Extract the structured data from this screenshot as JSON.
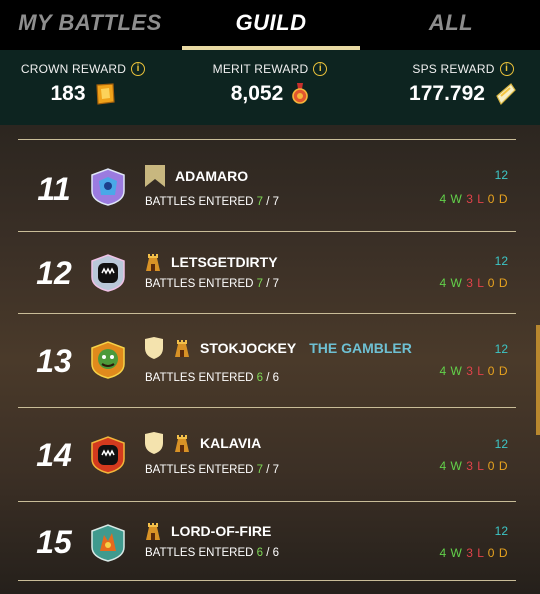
{
  "tabs": {
    "my_battles": "MY BATTLES",
    "guild": "GUILD",
    "all": "ALL"
  },
  "rewards": {
    "crown": {
      "label": "CROWN REWARD",
      "value": "183",
      "icon": "crown-token-icon"
    },
    "merit": {
      "label": "MERIT REWARD",
      "value": "8,052",
      "icon": "merit-medal-icon"
    },
    "sps": {
      "label": "SPS REWARD",
      "value": "177.792",
      "icon": "sps-crystal-icon"
    }
  },
  "entries": [
    {
      "rank": "11",
      "name": "ADAMARO",
      "title": "",
      "entered_label": "BATTLES ENTERED",
      "entered": "7",
      "total": "7",
      "points": "12",
      "w": "4",
      "l": "3",
      "d": "0",
      "badge": "banner",
      "tower": false
    },
    {
      "rank": "12",
      "name": "LETSGETDIRTY",
      "title": "",
      "entered_label": "BATTLES ENTERED",
      "entered": "7",
      "total": "7",
      "points": "12",
      "w": "4",
      "l": "3",
      "d": "0",
      "badge": "",
      "tower": true
    },
    {
      "rank": "13",
      "name": "STOKJOCKEY",
      "title": "THE GAMBLER",
      "entered_label": "BATTLES ENTERED",
      "entered": "6",
      "total": "6",
      "points": "12",
      "w": "4",
      "l": "3",
      "d": "0",
      "badge": "shield",
      "tower": true
    },
    {
      "rank": "14",
      "name": "KALAVIA",
      "title": "",
      "entered_label": "BATTLES ENTERED",
      "entered": "7",
      "total": "7",
      "points": "12",
      "w": "4",
      "l": "3",
      "d": "0",
      "badge": "shield",
      "tower": true
    },
    {
      "rank": "15",
      "name": "LORD-OF-FIRE",
      "title": "",
      "entered_label": "BATTLES ENTERED",
      "entered": "6",
      "total": "6",
      "points": "12",
      "w": "4",
      "l": "3",
      "d": "0",
      "badge": "",
      "tower": true
    }
  ],
  "labels": {
    "w": "W",
    "l": "L",
    "d": "D"
  },
  "colors": {
    "accent": "#e8d9a3",
    "win": "#62d14a",
    "loss": "#e0424a",
    "draw": "#e7a21f",
    "points": "#3dc6c6",
    "title": "#6ec0d3"
  }
}
